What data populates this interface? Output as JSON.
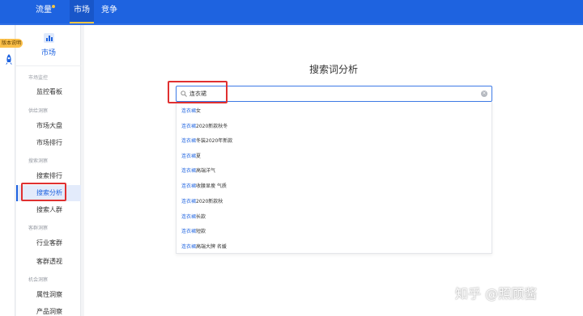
{
  "topnav": {
    "items": [
      {
        "label": "流量",
        "has_dot": true
      },
      {
        "label": "市场",
        "active": true
      },
      {
        "label": "竞争"
      }
    ]
  },
  "strip": {
    "tag_label": "版本说明"
  },
  "sidebar": {
    "header_label": "市场",
    "groups": [
      {
        "label": "市场监控",
        "items": [
          {
            "label": "监控看板"
          }
        ]
      },
      {
        "label": "供给洞察",
        "items": [
          {
            "label": "市场大盘"
          },
          {
            "label": "市场排行"
          }
        ]
      },
      {
        "label": "搜索洞察",
        "items": [
          {
            "label": "搜索排行"
          },
          {
            "label": "搜索分析",
            "active": true
          },
          {
            "label": "搜索人群"
          }
        ]
      },
      {
        "label": "客群洞察",
        "items": [
          {
            "label": "行业客群"
          },
          {
            "label": "客群透视"
          }
        ]
      },
      {
        "label": "机会洞察",
        "items": [
          {
            "label": "属性洞察"
          },
          {
            "label": "产品洞察"
          }
        ]
      }
    ]
  },
  "main": {
    "title": "搜索词分析",
    "search": {
      "value": "连衣裙",
      "placeholder": ""
    },
    "suggestions": [
      {
        "keyword": "连衣裙",
        "rest": "女"
      },
      {
        "keyword": "连衣裙",
        "rest": "2020新款秋冬"
      },
      {
        "keyword": "连衣裙",
        "rest": "冬装2020年新款"
      },
      {
        "keyword": "连衣裙",
        "rest": "夏"
      },
      {
        "keyword": "连衣裙",
        "rest": "高端洋气"
      },
      {
        "keyword": "连衣裙",
        "rest": "收腰显瘦 气质"
      },
      {
        "keyword": "连衣裙",
        "rest": "2020新款秋"
      },
      {
        "keyword": "连衣裙",
        "rest": "长款"
      },
      {
        "keyword": "连衣裙",
        "rest": "短款"
      },
      {
        "keyword": "连衣裙",
        "rest": "高端大牌 名媛"
      }
    ]
  },
  "watermark": "知乎 @照顾酱",
  "colors": {
    "brand_blue": "#1e63e0",
    "highlight_red": "#e03030",
    "tag_yellow": "#fbc04a"
  }
}
